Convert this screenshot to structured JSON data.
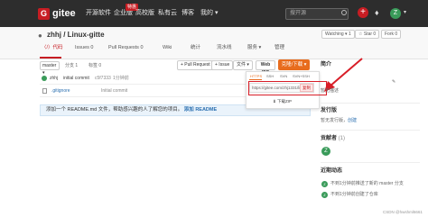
{
  "nav": {
    "logo_letter": "G",
    "logo": "gitee",
    "items": [
      "开源软件",
      "企业版",
      "高校版",
      "私有云",
      "博客",
      "我的 ▾"
    ],
    "badge": "特惠",
    "search_placeholder": "搜开源",
    "plus": "+",
    "avatar": "Z",
    "chevron": "▾"
  },
  "repo": {
    "title": "zhhj / Linux-gitte",
    "watching": "Watching ▾ 1",
    "star": "☆ Star 0",
    "fork": "Fork 0",
    "tabs": [
      "〈/〉代码",
      "Issues 0",
      "Pull Requests 0",
      "Wiki",
      "统计",
      "流水线",
      "服务 ▾",
      "管理"
    ]
  },
  "toolbar": {
    "branch": "master ▾",
    "branches": "分支 1",
    "tags": "标签 0",
    "pull_request": "+ Pull Request",
    "issue": "+ Issue",
    "file": "文件 ▾",
    "webide": "Web IDE",
    "clone": "克隆/下载 ▾"
  },
  "files": [
    {
      "author": "zhhj",
      "name": "",
      "message": "initial commit",
      "extra": "c5f7333",
      "time": "1分钟前"
    },
    {
      "author": "",
      "name": ".gitignore",
      "message": "Initial commit",
      "extra": "",
      "time": "1分钟前"
    }
  ],
  "readme": {
    "text": "添加一个 README.md 文件，帮助感兴趣的人了解您的项目。",
    "link": "添加 README"
  },
  "clone_popup": {
    "protocols": [
      "HTTPS",
      "SSH",
      "SVN",
      "SVN+SSH"
    ],
    "url": "https://gitee.com/zhj1331/linux-gitte.git",
    "copy": "复制",
    "download_zip": "⬇ 下载ZIP"
  },
  "sidebar": {
    "intro_title": "简介",
    "intro_edit": "✎",
    "intro_text": "暂无描述",
    "release_title": "发行版",
    "release_text": "暂无发行版，",
    "release_link": "创建",
    "contrib_title": "贡献者",
    "contrib_count": "(1)",
    "contrib_avatar": "Z",
    "activity_title": "近期动态",
    "activity": [
      "不到1分钟前推送了新的 master 分支",
      "不到1分钟前创建了仓库"
    ]
  },
  "watermark": "CSDN @hwshml6661",
  "colors": {
    "brand_red": "#c71d23",
    "clone_orange": "#e86c1d",
    "annotation_red": "#d81e28"
  }
}
